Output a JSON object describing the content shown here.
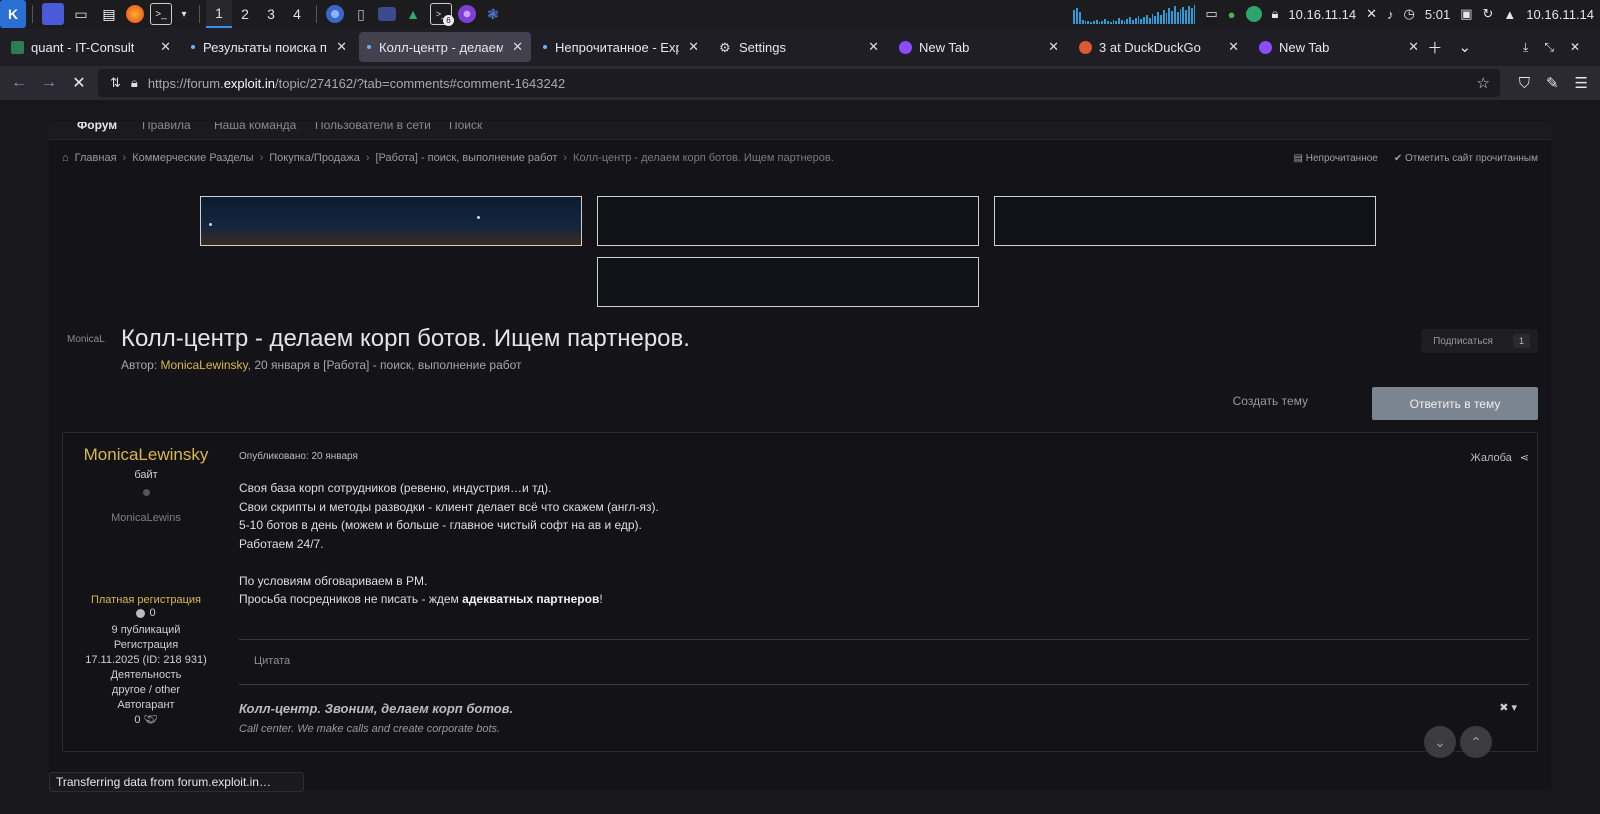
{
  "os": {
    "workspaces": [
      "1",
      "2",
      "3",
      "4"
    ],
    "active_workspace": "1",
    "tray": {
      "ip1": "10.16.11.14",
      "time": "5:01",
      "ip2": "10.16.11.14"
    },
    "terminal_badge": "6"
  },
  "tabs": [
    {
      "label": "quant - IT-Consult",
      "favicon_color": "#2e7d4f",
      "active": false
    },
    {
      "label": "Результаты поиска по \"к",
      "favicon_color": "dot",
      "active": false
    },
    {
      "label": "Колл-центр - делаем ко",
      "favicon_color": "dot",
      "active": true
    },
    {
      "label": "Непрочитанное - Exploit",
      "favicon_color": "dot",
      "active": false
    },
    {
      "label": "Settings",
      "favicon_color": "gear",
      "active": false
    },
    {
      "label": "New Tab",
      "favicon_color": "#8b4dff",
      "active": false
    },
    {
      "label": "3 at DuckDuckGo",
      "favicon_color": "#de5833",
      "active": false
    },
    {
      "label": "New Tab",
      "favicon_color": "#8b4dff",
      "active": false
    }
  ],
  "url": {
    "prefix": "https://forum.",
    "host": "exploit.in",
    "path": "/topic/274162/?tab=comments#comment-1643242"
  },
  "forum_nav": [
    "Форум",
    "Правила",
    "Наша команда",
    "Пользователи в сети",
    "Поиск"
  ],
  "breadcrumb": [
    "Главная",
    "Коммерческие Разделы",
    "Покупка/Продажа",
    "[Работа] - поиск, выполнение работ",
    "Колл-центр - делаем корп ботов. Ищем партнеров."
  ],
  "unread_link": "Непрочитанное",
  "mark_read_link": "Отметить сайт прочитанным",
  "topic": {
    "avatar_alt": "MonicaL",
    "title": "Колл-центр - делаем корп ботов. Ищем партнеров.",
    "meta_prefix": "Автор: ",
    "author": "MonicaLewinsky",
    "meta_suffix": ", 20 января в [Работа] - поиск, выполнение работ",
    "subscribe_label": "Подписаться",
    "subscribe_count": "1",
    "create_topic": "Создать тему",
    "reply_topic": "Ответить в тему"
  },
  "post": {
    "author_name": "MonicaLewinsky",
    "author_rank": "байт",
    "avatar_alt": "MonicaLewins",
    "group": "Платная регистрация",
    "reputation": "0",
    "publications": "9 публикаций",
    "registration_label": "Регистрация",
    "registration_value": "17.11.2025 (ID: 218 931)",
    "activity_label": "Деятельность",
    "activity_value": "другое / other",
    "guarantor_label": "Автогарант",
    "guarantor_value": "0",
    "date": "Опубликовано: 20 января",
    "report": "Жалоба",
    "lines": [
      "Своя база корп сотрудников (ревеню, индустрия…и тд).",
      "Свои скрипты и методы разводки - клиент делает всё что скажем (англ-яз).",
      "5-10 ботов в день (можем и больше - главное чистый софт на ав и едр).",
      "Работаем 24/7."
    ],
    "line5": "По условиям обговариваем в PM.",
    "line6_prefix": "Просьба посредников не писать - ждем ",
    "line6_bold": "адекватных партнеров",
    "line6_suffix": "!",
    "quote_label": "Цитата",
    "signature_title": "Колл-центр. Звоним, делаем корп ботов.",
    "signature_sub": "Call center. We make calls and create corporate bots."
  },
  "status_bar": "Transferring data from forum.exploit.in…"
}
